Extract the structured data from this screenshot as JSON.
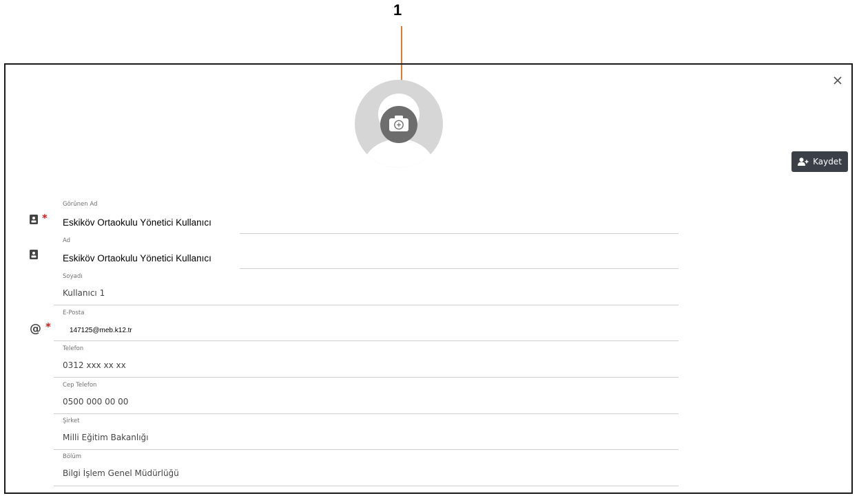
{
  "callout": {
    "number": "1"
  },
  "header": {
    "close_icon": "close-icon",
    "save_label": "Kaydet",
    "save_icon": "user-plus-icon"
  },
  "avatar": {
    "upload_icon": "camera-plus-icon"
  },
  "fields": [
    {
      "label": "Görünen Ad",
      "value": "Eskiköv Ortaokulu Yönetici Kullanıcı",
      "required": true,
      "icon": "id-card-icon"
    },
    {
      "label": "Ad",
      "value": "Eskiköv Ortaokulu Yönetici Kullanıcı",
      "required": false,
      "icon": "id-card-icon"
    },
    {
      "label": "Soyadı",
      "value": "Kullanıcı 1"
    },
    {
      "label": "E-Posta",
      "value": "147125@meb.k12.tr",
      "required": true,
      "icon": "at-icon"
    },
    {
      "label": "Telefon",
      "value": "0312 xxx xx xx"
    },
    {
      "label": "Cep Telefon",
      "value": "0500 000 00 00"
    },
    {
      "label": "Şirket",
      "value": "Milli Eğitim Bakanlığı"
    },
    {
      "label": "Bölüm",
      "value": "Bilgi İşlem Genel Müdürlüğü"
    }
  ],
  "colors": {
    "callout_arrow": "#e07a2e",
    "save_button": "#3a3f48",
    "required": "#d11a1a",
    "avatar_bg": "#d6d6d6"
  }
}
